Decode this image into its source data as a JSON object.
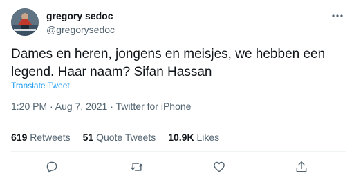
{
  "author": {
    "name": "gregory sedoc",
    "handle": "@gregorysedoc"
  },
  "tweet": {
    "lines": [
      "Dames en heren, jongens en meisjes, we hebben een",
      "legend. Haar naam? Sifan Hassan"
    ],
    "translate_label": "Translate Tweet",
    "meta": "1:20 PM · Aug 7, 2021 · Twitter for iPhone"
  },
  "stats": {
    "retweets_count": "619",
    "retweets_label": "Retweets",
    "quotes_count": "51",
    "quotes_label": "Quote Tweets",
    "likes_count": "10.9K",
    "likes_label": "Likes"
  },
  "icons": {
    "more": "more-dots-icon",
    "reply": "reply-icon",
    "retweet": "retweet-icon",
    "like": "heart-icon",
    "share": "share-icon"
  },
  "colors": {
    "link": "#1d9bf0",
    "secondary_text": "#536471",
    "primary_text": "#0f1419",
    "divider": "#eff3f4"
  }
}
